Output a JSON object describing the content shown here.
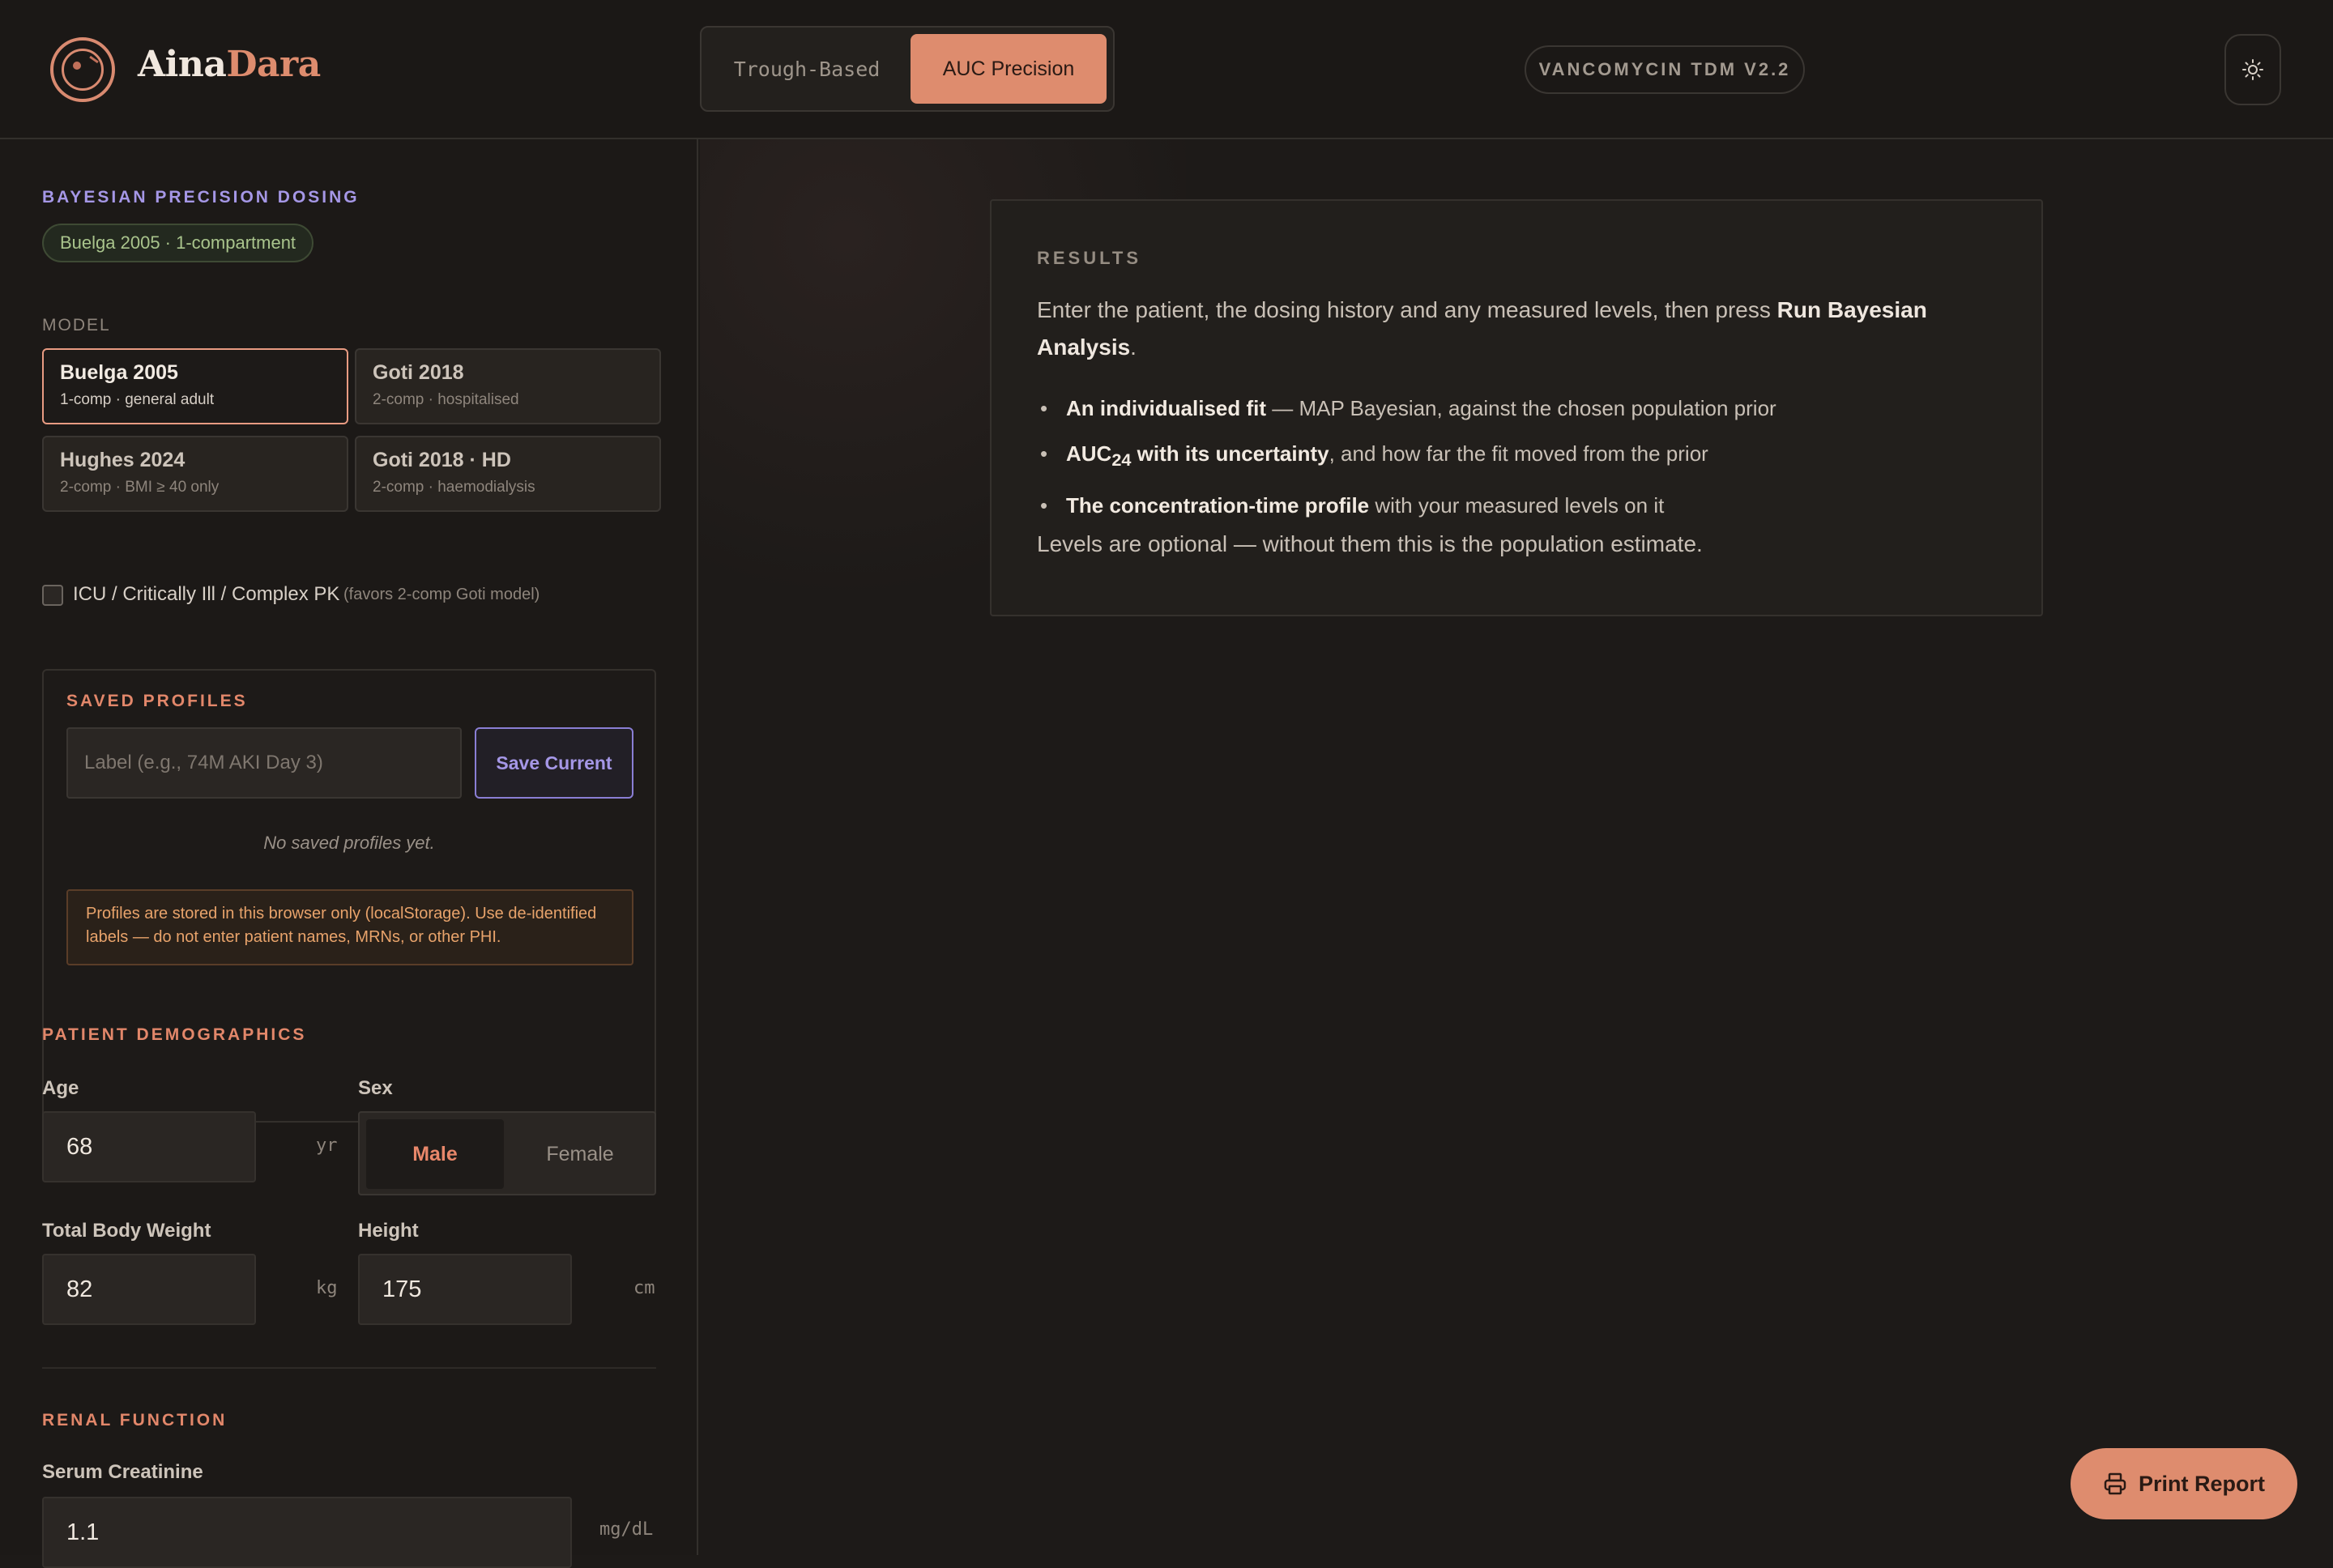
{
  "brand": {
    "part1": "Aina",
    "part2": "Dara"
  },
  "modes": {
    "trough": "Trough-Based",
    "auc": "AUC Precision",
    "active": "auc"
  },
  "version": "VANCOMYCIN TDM V2.2",
  "icons": {
    "logo": "smiley-ring-logo",
    "theme": "sun-icon",
    "print": "printer-icon"
  },
  "sidebar": {
    "section_title": "BAYESIAN PRECISION DOSING",
    "model_tag": "Buelga 2005 · 1-compartment",
    "model_label": "MODEL",
    "models": [
      {
        "name": "Buelga 2005",
        "desc": "1-comp · general adult",
        "selected": true
      },
      {
        "name": "Goti 2018",
        "desc": "2-comp · hospitalised",
        "selected": false
      },
      {
        "name": "Hughes 2024",
        "desc": "2-comp · BMI ≥ 40 only",
        "selected": false
      },
      {
        "name": "Goti 2018 · HD",
        "desc": "2-comp · haemodialysis",
        "selected": false
      }
    ],
    "icu": {
      "label": "ICU / Critically Ill / Complex PK",
      "hint": "(favors 2-comp Goti model)",
      "checked": false
    },
    "profiles": {
      "title": "SAVED PROFILES",
      "placeholder": "Label (e.g., 74M AKI Day 3)",
      "save_label": "Save Current",
      "empty": "No saved profiles yet.",
      "warning": "Profiles are stored in this browser only (localStorage). Use de-identified labels — do not enter patient names, MRNs, or other PHI."
    },
    "demographics": {
      "title": "PATIENT DEMOGRAPHICS",
      "age_label": "Age",
      "age": "68",
      "age_unit": "yr",
      "sex_label": "Sex",
      "sex_male": "Male",
      "sex_female": "Female",
      "sex_selected": "Male",
      "weight_label": "Total Body Weight",
      "weight": "82",
      "weight_unit": "kg",
      "height_label": "Height",
      "height": "175",
      "height_unit": "cm"
    },
    "renal": {
      "title": "RENAL FUNCTION",
      "scr_label": "Serum Creatinine",
      "scr": "1.1",
      "scr_unit": "mg/dL"
    }
  },
  "results": {
    "title": "RESULTS",
    "intro": "Enter the patient, the dosing history and any measured levels, then press",
    "intro_bold": "Run Bayesian Analysis",
    "intro_end": ".",
    "b1_bold": "An individualised fit",
    "b1_rest": " — MAP Bayesian, against the chosen population prior",
    "b2_bold_a": "AUC",
    "b2_sub": "24",
    "b2_bold_b": " with its uncertainty",
    "b2_rest": ", and how far the fit moved from the prior",
    "b3_bold": "The concentration-time profile",
    "b3_rest": " with your measured levels on it",
    "note": "Levels are optional — without them this is the population estimate."
  },
  "print_label": "Print Report",
  "colors": {
    "accent": "#de8c6e",
    "purple": "#a597e6",
    "bg": "#1d1a18"
  }
}
